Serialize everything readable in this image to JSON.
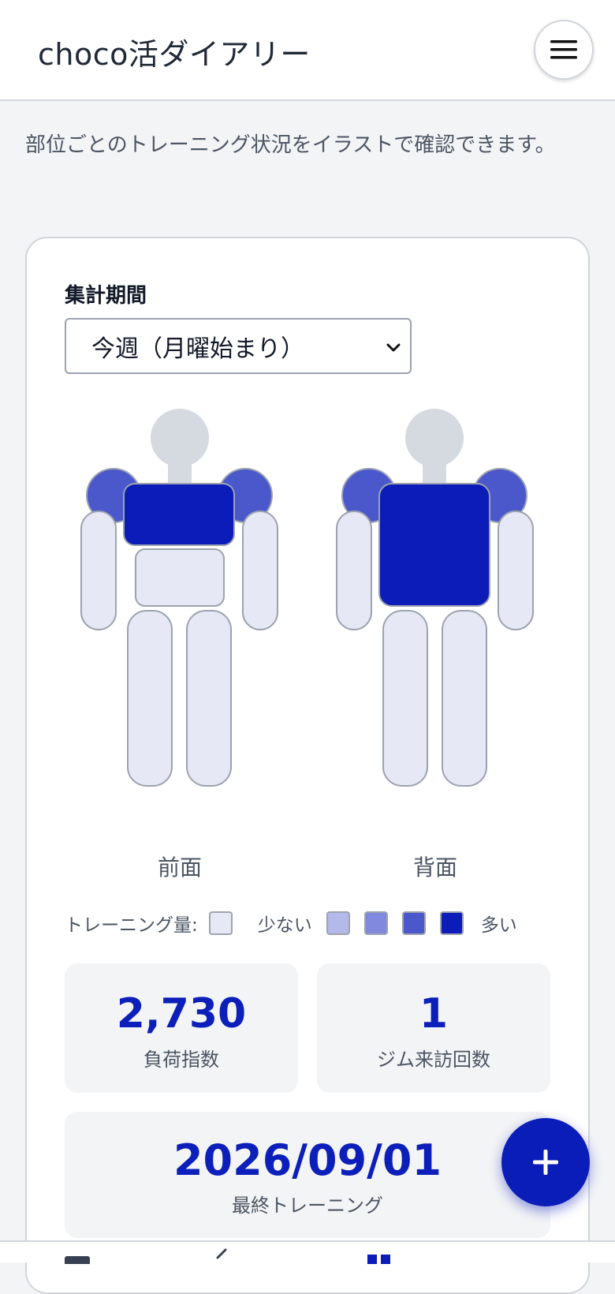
{
  "header": {
    "title": "choco活ダイアリー",
    "menu_icon": "hamburger-icon"
  },
  "intro": {
    "text": "部位ごとのトレーニング状況をイラストで確認できます。"
  },
  "period": {
    "label": "集計期間",
    "selected": "今週（月曜始まり）"
  },
  "figures": {
    "front_label": "前面",
    "back_label": "背面"
  },
  "colors": {
    "level0": "#e6e8f6",
    "level1": "#b3b9e8",
    "level2": "#8089dd",
    "level3": "#4a58cc",
    "level4": "#0b1cb8",
    "head": "#d5d9e0",
    "outline": "#9ca3af",
    "accent": "#0d1fba"
  },
  "muscle_levels": {
    "shoulders": 3,
    "chest": 4,
    "abs": 0,
    "arms": 0,
    "legs": 0,
    "back": 4
  },
  "legend": {
    "label": "トレーニング量:",
    "low": "少ない",
    "high": "多い"
  },
  "stats": {
    "load": {
      "value": "2,730",
      "caption": "負荷指数"
    },
    "gym_visits": {
      "value": "1",
      "caption": "ジム来訪回数"
    },
    "last_training": {
      "value": "2026/09/01",
      "caption": "最終トレーニング"
    }
  },
  "fab": {
    "icon": "plus-icon"
  }
}
